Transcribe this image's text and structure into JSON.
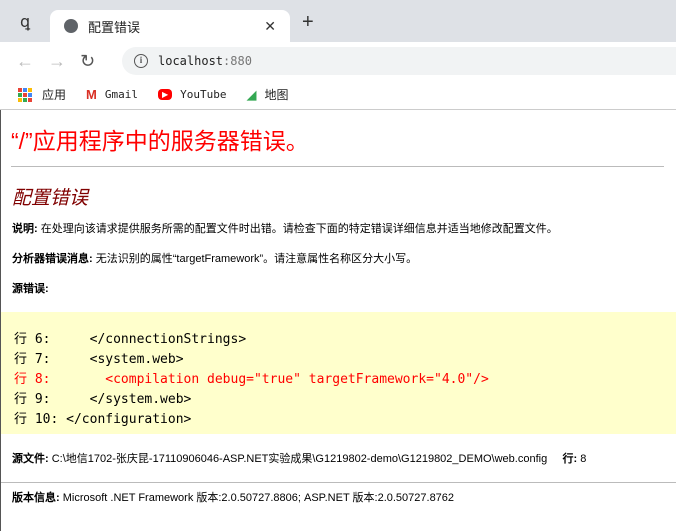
{
  "browser": {
    "tab_title": "配置错误",
    "url_host": "localhost",
    "url_port": ":880",
    "bookmarks": [
      {
        "label": "应用",
        "icon": "apps-grid-icon"
      },
      {
        "label": "Gmail",
        "icon": "gmail-icon"
      },
      {
        "label": "YouTube",
        "icon": "youtube-icon"
      },
      {
        "label": "地图",
        "icon": "maps-icon"
      }
    ]
  },
  "page": {
    "title": "“/”应用程序中的服务器错误。",
    "subtitle": "配置错误",
    "description_label": "说明:",
    "description": " 在处理向该请求提供服务所需的配置文件时出错。请检查下面的特定错误详细信息并适当地修改配置文件。",
    "parser_label": "分析器错误消息:",
    "parser_message": " 无法识别的属性“targetFramework”。请注意属性名称区分大小写。",
    "source_label": "源错误:",
    "code_lines": [
      {
        "text": "行 6:     </connectionStrings>",
        "error": false
      },
      {
        "text": "行 7:     <system.web>",
        "error": false
      },
      {
        "text": "行 8:       <compilation debug=\"true\" targetFramework=\"4.0\"/>",
        "error": true
      },
      {
        "text": "行 9:     </system.web>",
        "error": false
      },
      {
        "text": "行 10: </configuration>",
        "error": false
      }
    ],
    "source_file_label": "源文件:",
    "source_file": " C:\\地信1702-张庆昆-17110906046-ASP.NET实验成果\\G1219802-demo\\G1219802_DEMO\\web.config",
    "line_label": "行:",
    "line_value": " 8",
    "version_label": "版本信息:",
    "version": " Microsoft .NET Framework 版本:2.0.50727.8806; ASP.NET 版本:2.0.50727.8762"
  },
  "colors": {
    "error": "#ff0000",
    "subtitle": "#800000",
    "code_bg": "#ffffcc"
  }
}
